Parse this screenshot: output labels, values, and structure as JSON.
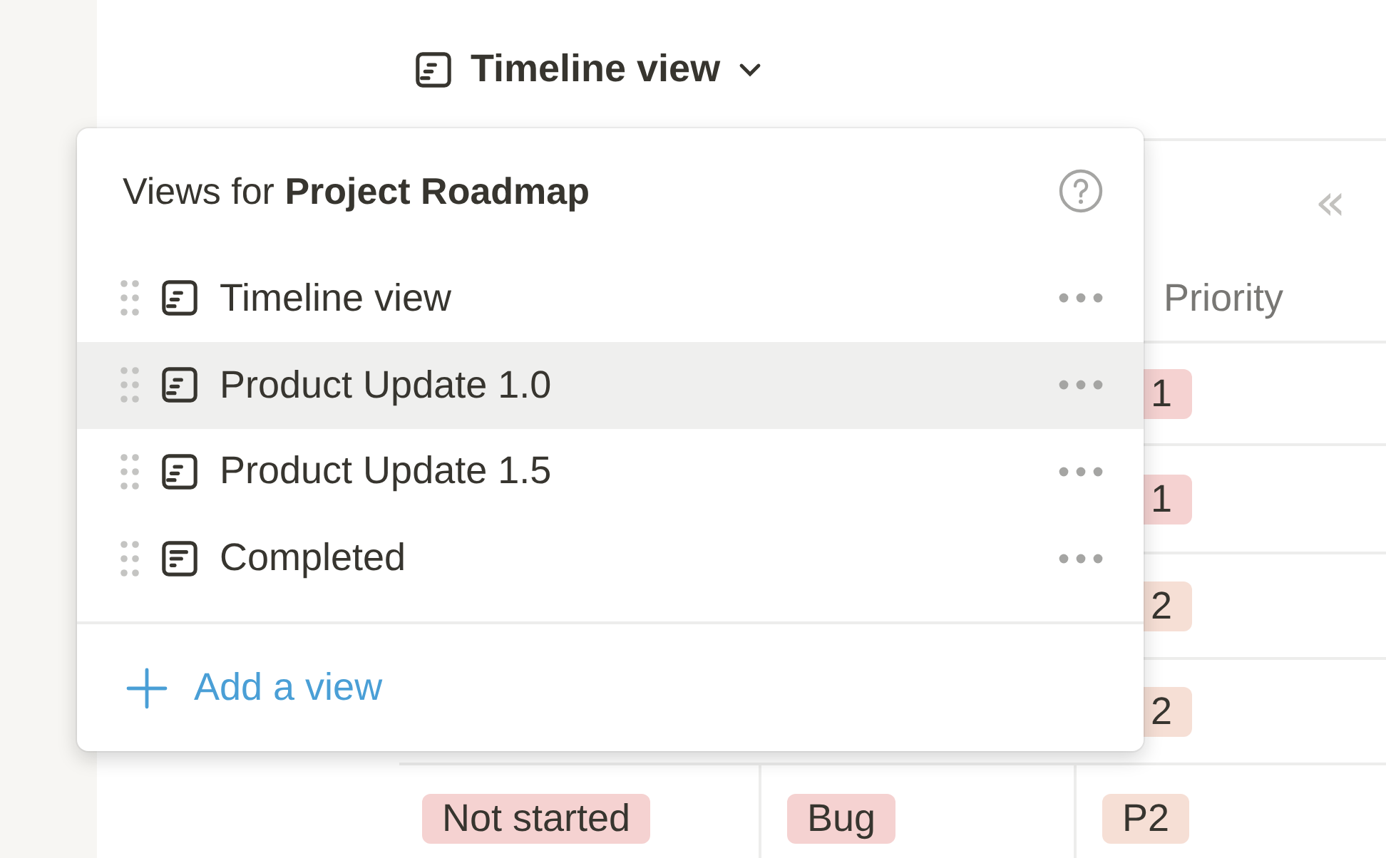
{
  "view_switcher": {
    "label": "Timeline view"
  },
  "views_menu": {
    "title": "Views for **Project Roadmap**",
    "items": [
      {
        "label": "Timeline view",
        "kind": "timeline",
        "selected": false
      },
      {
        "label": "Product Update 1.0",
        "kind": "timeline",
        "selected": true
      },
      {
        "label": "Product Update 1.5",
        "kind": "timeline",
        "selected": false
      },
      {
        "label": "Completed",
        "kind": "list",
        "selected": false
      }
    ],
    "add_label": "Add a view"
  },
  "table": {
    "collapse_glyph": "«",
    "columns": [
      {
        "label": "Priority"
      }
    ],
    "rows": [
      {
        "priority": {
          "label": "1",
          "color": "#f5d2d1",
          "kind": "cut"
        }
      },
      {
        "priority": {
          "label": "1",
          "color": "#f5d2d1",
          "kind": "cut"
        }
      },
      {
        "priority": {
          "label": "2",
          "color": "#f6dfd5",
          "kind": "cut"
        }
      },
      {
        "priority": {
          "label": "2",
          "color": "#f6dfd5",
          "kind": "cut"
        }
      },
      {
        "status": {
          "label": "Not started",
          "color": "#f5d2d1"
        },
        "type": {
          "label": "Bug",
          "color": "#f5d2d1"
        },
        "priority": {
          "label": "P2",
          "color": "#f6dfd5"
        }
      }
    ]
  }
}
